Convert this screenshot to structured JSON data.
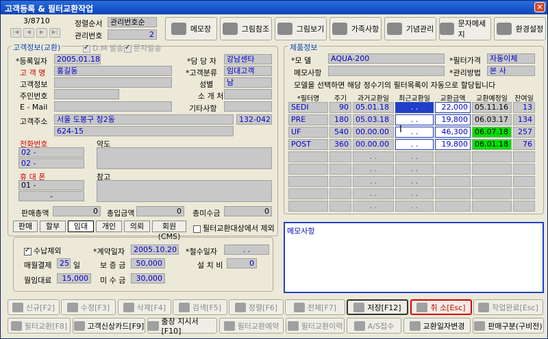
{
  "window": {
    "title": "고객등록 & 필터교환작업",
    "close": "✕"
  },
  "record": {
    "position": "3/8710"
  },
  "sort": {
    "label": "정렬순서",
    "value": "관리번호순"
  },
  "mgmt": {
    "label": "관리번호",
    "value": "2"
  },
  "toolbar": {
    "memo": "메모장",
    "picref": "그림참조",
    "picview": "그림보기",
    "family": "가족사항",
    "anniv": "기념관리",
    "sms": "문자메세지",
    "settings": "환경설정"
  },
  "customer_section": {
    "title": "고객정보(교환)",
    "dm": "D.M 발송",
    "sms": "문자발송"
  },
  "customer": {
    "reg_date": {
      "label": "*등록일자",
      "value": "2005.01.18"
    },
    "staff": {
      "label": "*담 당 자",
      "value": "강남센타"
    },
    "name": {
      "label": "고 객 명",
      "value": "홍길동"
    },
    "category": {
      "label": "*고객분류",
      "value": "임대고객"
    },
    "info": {
      "label": "고객정보"
    },
    "gender": {
      "label": "성별",
      "value": "남"
    },
    "ssn": {
      "label": "주민번호"
    },
    "referrer": {
      "label": "소 개 처"
    },
    "email": {
      "label": "E - Mail"
    },
    "other": {
      "label": "기타사항"
    },
    "address": {
      "label": "고객주소",
      "line1": "서울 도봉구 창2동",
      "zip": "132-042",
      "line2": "624-15"
    },
    "phone": {
      "label": "전화번호",
      "v1": "02  -",
      "v2": "02  -"
    },
    "mobile": {
      "label": "휴 대 폰",
      "v1": "01  -",
      "v2": "-"
    },
    "map": {
      "label": "약도"
    },
    "note": {
      "label": "참고"
    }
  },
  "totals": {
    "sales_label": "판매총액",
    "sales": "0",
    "deposit_label": "총입금액",
    "deposit": "0",
    "unpaid_label": "총미수금",
    "unpaid": "0"
  },
  "tabs": [
    "판매",
    "할부",
    "임대",
    "개인",
    "의뢰",
    "회원(CMS)"
  ],
  "filter_exclude": "필터교환대상에서 제외",
  "contract": {
    "collect_exclude": "수납제외",
    "contract_date_label": "*계약일자",
    "contract_date": "2005.10.20",
    "removal_label": "*철수일자",
    "removal": ". .",
    "monthly_settle_label": "매월결제",
    "monthly_settle": "25",
    "monthly_settle_unit": "일",
    "deposit_label": "보 증 금",
    "deposit": "50,000",
    "install_label": "설 치 비",
    "install": "0",
    "monthly_rent_label": "월임대료",
    "monthly_rent": "15,000",
    "unpaid_label": "미 수 금",
    "unpaid": "30,000"
  },
  "product_section": {
    "title": "제품정보"
  },
  "product": {
    "model_label": "*모    델",
    "model": "AQUA-200",
    "filter_price_label": "*필터가격",
    "filter_price": "자동이체",
    "memo_label": "메모사항",
    "manage_label": "*관리방법",
    "manage": "본 사",
    "hint": "모델을 선택하면 해당 정수기의 필터목록이 자동으로 할당됩니다"
  },
  "filter_headers": [
    "*필터명",
    "주기",
    "과거교환일",
    "최근교환일",
    "교환금액",
    "교환예정일",
    "잔여일"
  ],
  "filters": [
    {
      "name": "SEDI",
      "cycle": "90",
      "past": "05.01.18",
      "recent": ". .",
      "amount": "22,000",
      "due": "05.11.16",
      "remain": "13"
    },
    {
      "name": "PRE",
      "cycle": "180",
      "past": "05.03.18",
      "recent": ". .",
      "amount": "19,800",
      "due": "06.03.17",
      "remain": "134"
    },
    {
      "name": "UF",
      "cycle": "540",
      "past": "00.00.00",
      "recent": ". .",
      "amount": "46,300",
      "due": "06.07.18",
      "remain": "257"
    },
    {
      "name": "POST",
      "cycle": "360",
      "past": "00.00.00",
      "recent": ". .",
      "amount": "19,800",
      "due": "06.01.18",
      "remain": "76"
    }
  ],
  "memo_area": "메모사항",
  "bottom1": [
    "신규[F2]",
    "수정[F3]",
    "삭제[F4]",
    "검색[F5]",
    "정렬[F6]",
    "전체[F7]",
    "저장[F12]",
    "취 소[Esc]",
    "작업완료[Esc]"
  ],
  "bottom2": [
    "필터교환[F8]",
    "고객신상카드[F9]",
    "출장 지시서[F10]",
    "필터교환예약",
    "필터교환이력",
    "A/S접수",
    "교환일자변경",
    "판매구분(구비전)"
  ],
  "colors": {
    "title": "#0b44b8",
    "accent": "#2040c8",
    "green": "#00e000",
    "red": "#d40000"
  }
}
